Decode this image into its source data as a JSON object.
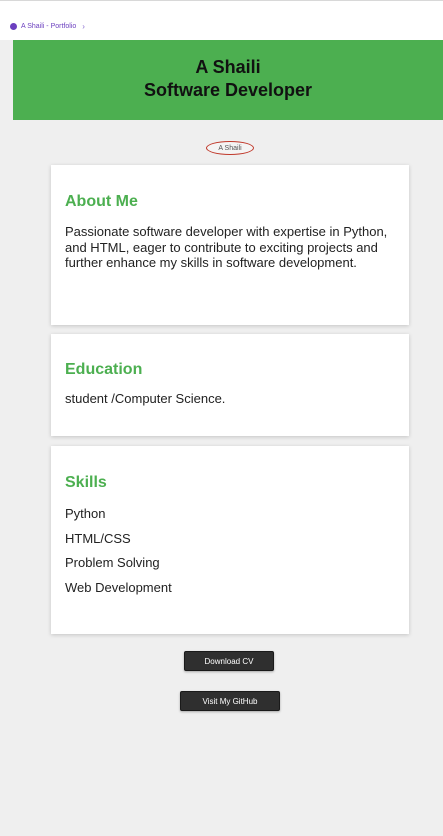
{
  "browser": {
    "tab_title": "A Shaili - Portfolio",
    "chevron": "›",
    "icon": "globe-icon"
  },
  "header": {
    "name": "A Shaili",
    "role": "Software Developer",
    "background_color": "#4caf50"
  },
  "avatar": {
    "alt_text": "A Shaili"
  },
  "sections": {
    "about": {
      "title": "About Me",
      "body": "Passionate software developer with expertise in Python, and HTML, eager to contribute to exciting projects and further enhance my skills in software development."
    },
    "education": {
      "title": "Education",
      "body": "student /Computer Science."
    },
    "skills": {
      "title": "Skills",
      "items": [
        "Python",
        "HTML/CSS",
        "Problem Solving",
        "Web Development"
      ]
    }
  },
  "actions": {
    "download_cv": "Download CV",
    "github": "Visit My GitHub"
  },
  "colors": {
    "accent": "#4caf50",
    "button_bg": "#2f2f2f",
    "page_bg": "#efefef"
  }
}
